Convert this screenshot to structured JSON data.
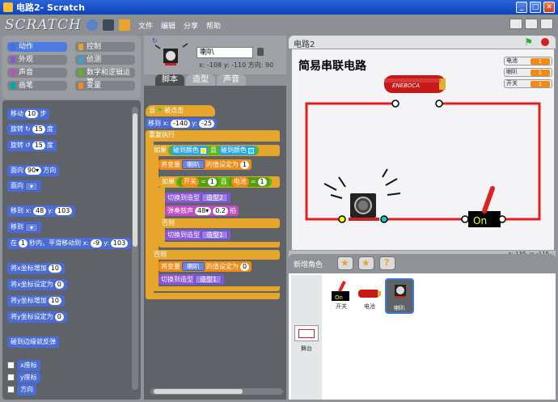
{
  "window": {
    "title": "电路2- Scratch"
  },
  "menubar": {
    "logo": "SCRATCH",
    "menus": [
      "文件",
      "编辑",
      "分享",
      "帮助"
    ]
  },
  "categories": [
    {
      "label": "动作",
      "color": "#4a6cd4",
      "selected": true
    },
    {
      "label": "控制",
      "color": "#e6a62c"
    },
    {
      "label": "外观",
      "color": "#8a55d7"
    },
    {
      "label": "侦测",
      "color": "#2ea5d9"
    },
    {
      "label": "声音",
      "color": "#c14bc1"
    },
    {
      "label": "数字和逻辑运算",
      "color": "#5cb712"
    },
    {
      "label": "画笔",
      "color": "#00a7a7"
    },
    {
      "label": "变量",
      "color": "#f08c14"
    }
  ],
  "palette": {
    "move": {
      "pre": "移动",
      "val": "10",
      "post": "步"
    },
    "turn_right": {
      "pre": "旋转",
      "val": "15",
      "post": "度"
    },
    "turn_left": {
      "pre": "旋转",
      "val": "15",
      "post": "度"
    },
    "point_dir": {
      "pre": "面向",
      "val": "90▾",
      "post": "方向"
    },
    "point_to": {
      "pre": "面向"
    },
    "goto_xy": {
      "pre": "移到 x:",
      "x": "48",
      "mid": "y:",
      "y": "103"
    },
    "goto": {
      "pre": "移到"
    },
    "glide": {
      "pre": "在",
      "secs": "1",
      "mid": "秒内，平滑移动到 x:",
      "x": "-9",
      "mid2": "y:",
      "y": "103"
    },
    "change_x": {
      "pre": "将x坐标增加",
      "val": "10"
    },
    "set_x": {
      "pre": "将x坐标设定为",
      "val": "0"
    },
    "change_y": {
      "pre": "将y坐标增加",
      "val": "10"
    },
    "set_y": {
      "pre": "将y坐标设定为",
      "val": "0"
    },
    "bounce": {
      "label": "碰到边缘就反弹"
    },
    "xpos": {
      "label": "x座标"
    },
    "ypos": {
      "label": "y座标"
    },
    "direction": {
      "label": "方向"
    }
  },
  "sprite": {
    "name": "喇叭",
    "x_label": "x: -108",
    "y_label": "y: -110",
    "dir_label": "方向: 90"
  },
  "tabs": [
    "脚本",
    "造型",
    "声音"
  ],
  "script": {
    "hat": {
      "pre": "当",
      "post": "被点击"
    },
    "goto": {
      "pre": "移到 x:",
      "x": "-140",
      "mid": "y:",
      "y": "-25"
    },
    "forever": "重复执行",
    "if1": {
      "pre": "如果",
      "t1": "碰到颜色",
      "and": "且",
      "t2": "碰到颜色"
    },
    "setvar1": {
      "pre": "将变量",
      "var": "喇叭",
      "mid": "的值设定为",
      "val": "1"
    },
    "if2": {
      "pre": "如果",
      "v1": "开关",
      "eq1": "=",
      "n1": "1",
      "and": "且",
      "v2": "电池",
      "eq2": "=",
      "n2": "1"
    },
    "costume2": {
      "pre": "切换到造型",
      "val": "造型2"
    },
    "playnote": {
      "pre": "弹奏鼓声",
      "val": "48▾",
      "beats": "0.2",
      "post": "拍"
    },
    "else1": "否则",
    "costume1": {
      "pre": "切换到造型",
      "val": "造型1"
    },
    "else2": "否则",
    "setvar0": {
      "pre": "将变量",
      "var": "喇叭",
      "mid": "的值设定为",
      "val": "0"
    },
    "costume1b": {
      "pre": "切换到造型",
      "val": "造型1"
    }
  },
  "stage": {
    "name": "电路2",
    "heading": "简易串联电路",
    "battery_label": "ENEBOCA",
    "switch_label": "On",
    "watchers": [
      {
        "label": "电池",
        "value": "1"
      },
      {
        "label": "喇叭",
        "value": "1"
      },
      {
        "label": "开关",
        "value": "1"
      }
    ],
    "coords": {
      "x": "x: 135",
      "y": "y: -115"
    }
  },
  "sprites_panel": {
    "title": "新增角色",
    "items": [
      {
        "label": "开关"
      },
      {
        "label": "电池"
      },
      {
        "label": "喇叭",
        "selected": true
      }
    ],
    "stage_label": "舞台"
  }
}
